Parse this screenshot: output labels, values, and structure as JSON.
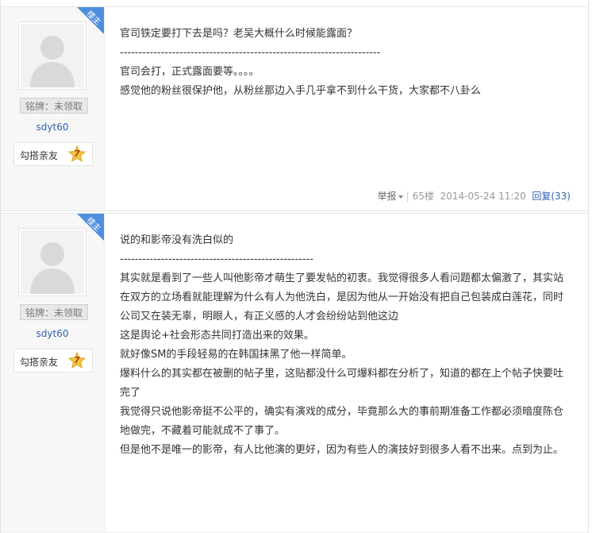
{
  "posts": [
    {
      "corner_label": "楼主",
      "badge_title": "铭牌：未领取",
      "username": "sdyt60",
      "level_name": "勾搭亲友",
      "level_number": "7",
      "lines": [
        "官司铁定要打下去是吗？老吴大概什么时候能露面？",
        "----------------------------------------------------------------------",
        "官司会打，正式露面要等。。。。",
        "感觉他的粉丝很保护他，从粉丝那边入手几乎拿不到什么干货，大家都不八卦么"
      ],
      "report_label": "举报",
      "floor": "65楼",
      "timestamp": "2014-05-24 11:20",
      "reply_label": "回复(33)"
    },
    {
      "corner_label": "楼主",
      "badge_title": "铭牌：未领取",
      "username": "sdyt60",
      "level_name": "勾搭亲友",
      "level_number": "7",
      "lines": [
        "说的和影帝没有洗白似的",
        "----------------------------------------------------",
        "其实就是看到了一些人叫他影帝才萌生了要发帖的初衷。我觉得很多人看问题都太偏激了，其实站在双方的立场看就能理解为什么有人为他洗白，是因为他从一开始没有把自己包装成白莲花，同时公司又在装无辜，明眼人，有正义感的人才会纷纷站到他这边",
        "这是舆论+社会形态共同打造出来的效果。",
        "就好像SM的手段轻易的在韩国抹黑了他一样简单。",
        "爆料什么的其实都在被删的帖子里，这贴都没什么可爆料都在分析了，知道的都在上个帖子快要吐完了",
        "我觉得只说他影帝挺不公平的，确实有演戏的成分，毕竟那么大的事前期准备工作都必须暗度陈仓地做完，不藏着可能就成不了事了。",
        "但是他不是唯一的影帝，有人比他演的更好，因为有些人的演技好到很多人看不出来。点到为止。"
      ]
    }
  ],
  "colors": {
    "link": "#2d64b3",
    "corner_badge": "#4f8fe0",
    "sidebar_bg": "#f7f7f7",
    "meta": "#999999"
  }
}
